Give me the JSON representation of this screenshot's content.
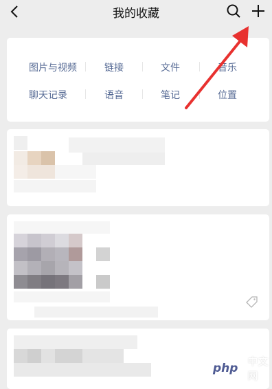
{
  "header": {
    "title": "我的收藏",
    "back_icon": "chevron-left-icon",
    "search_icon": "search-icon",
    "add_icon": "plus-icon"
  },
  "categories": [
    {
      "label": "图片与视频"
    },
    {
      "label": "链接"
    },
    {
      "label": "文件"
    },
    {
      "label": "音乐"
    },
    {
      "label": "聊天记录"
    },
    {
      "label": "语音"
    },
    {
      "label": "笔记"
    },
    {
      "label": "位置"
    }
  ],
  "colors": {
    "background": "#ededed",
    "category_text": "#576b95",
    "annotation_arrow": "#e8312f"
  },
  "watermark": {
    "logo": "php",
    "text": "中文网"
  }
}
